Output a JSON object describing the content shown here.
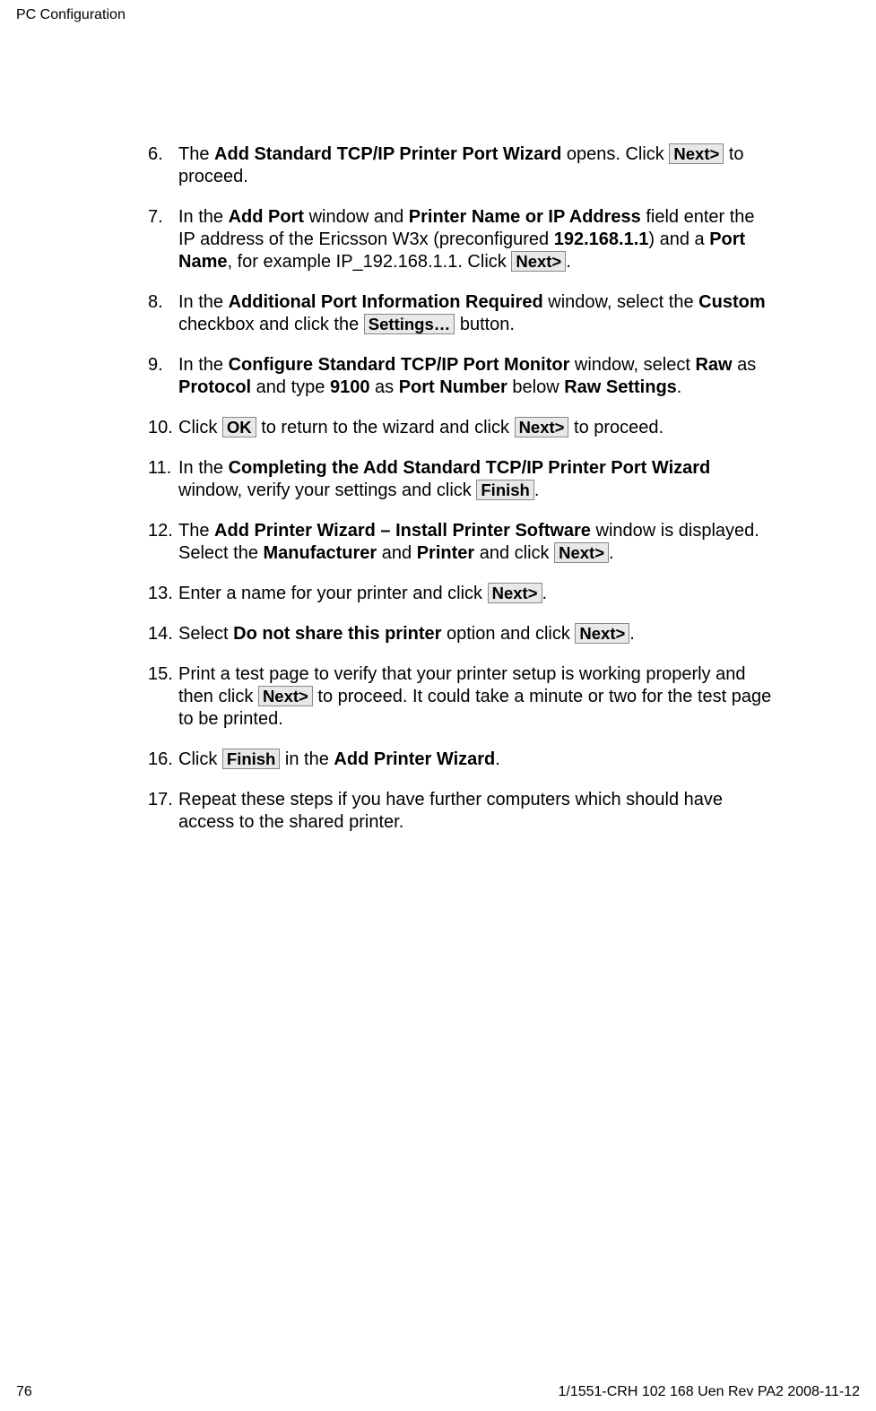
{
  "header": {
    "title": "PC Configuration"
  },
  "buttons": {
    "next": "Next>",
    "settings": "Settings…",
    "ok": "OK",
    "finish": "Finish",
    "finish_wide": " Finish "
  },
  "bold": {
    "wizard_title": "Add Standard TCP/IP Printer Port Wizard",
    "add_port": "Add Port",
    "printer_name_or_ip": "Printer Name or IP Address",
    "preconfigured_ip": "192.168.1.1",
    "port_name": "Port Name",
    "additional_port_info": "Additional Port Information Required",
    "custom": "Custom",
    "configure_monitor": "Configure Standard TCP/IP Port Monitor",
    "raw": "Raw",
    "protocol": "Protocol",
    "port_9100": "9100",
    "port_number": "Port Number",
    "raw_settings": "Raw Settings",
    "completing_wizard": "Completing the Add Standard TCP/IP Printer Port Wizard",
    "install_software": "Add Printer Wizard – Install Printer Software",
    "manufacturer": "Manufacturer",
    "printer": "Printer",
    "do_not_share": "Do not share this printer",
    "add_printer_wizard": "Add Printer Wizard"
  },
  "text": {
    "s6_a": "The ",
    "s6_b": " opens. Click ",
    "s6_c": " to proceed.",
    "s7_a": "In the ",
    "s7_b": " window and ",
    "s7_c": " field enter the IP address of the Ericsson W3x (preconfigured ",
    "s7_d": ") and a ",
    "s7_e": ", for example IP_192.168.1.1.  Click ",
    "s7_f": ".",
    "s8_a": "In the ",
    "s8_b": " window, select the ",
    "s8_c": " checkbox and click the ",
    "s8_d": " button.",
    "s9_a": "In the ",
    "s9_b": " window, select ",
    "s9_c": " as ",
    "s9_d": " and type ",
    "s9_e": " as ",
    "s9_f": " below ",
    "s9_g": ".",
    "s10_a": "Click ",
    "s10_b": " to return to the wizard and click ",
    "s10_c": " to proceed.",
    "s11_a": "In the ",
    "s11_b": " window, verify your settings and click ",
    "s11_c": ".",
    "s12_a": "The ",
    "s12_b": " window is displayed. Select the ",
    "s12_c": " and ",
    "s12_d": " and click ",
    "s12_e": ".",
    "s13_a": "Enter a name for your printer and click ",
    "s13_b": ".",
    "s14_a": "Select ",
    "s14_b": " option and click ",
    "s14_c": ".",
    "s15_a": "Print a test page to verify that your printer setup is working properly and then click ",
    "s15_b": " to proceed. It could take a minute or two for the test page to be printed.",
    "s16_a": "Click ",
    "s16_b": " in the ",
    "s16_c": ".",
    "s17_a": "Repeat these steps if you have further computers which should have access to the shared printer."
  },
  "nums": {
    "n6": "6.",
    "n7": "7.",
    "n8": "8.",
    "n9": "9.",
    "n10": "10.",
    "n11": "11.",
    "n12": "12.",
    "n13": "13.",
    "n14": "14.",
    "n15": "15.",
    "n16": "16.",
    "n17": "17."
  },
  "footer": {
    "page": "76",
    "docref": "1/1551-CRH 102 168 Uen Rev PA2  2008-11-12"
  }
}
